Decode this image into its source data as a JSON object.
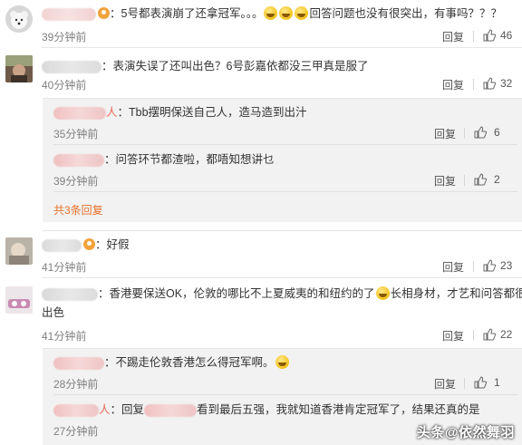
{
  "comments": [
    {
      "text": "：5号都表演崩了还拿冠军。。。",
      "text2": "回答问题也没有很突出，有事吗？？？",
      "time": "39分钟前",
      "reply_label": "回复",
      "likes": "46"
    },
    {
      "text": "：表演失误了还叫出色？6号彭嘉依都没三甲真是服了",
      "time": "40分钟前",
      "reply_label": "回复",
      "likes": "32",
      "replies": [
        {
          "text": "：Tbb摆明保送自己人，造马造到出汁",
          "time": "35分钟前",
          "reply_label": "回复",
          "likes": "6"
        },
        {
          "text": "：问答环节都渣啦，都唔知想讲乜",
          "time": "39分钟前",
          "reply_label": "回复",
          "likes": "2"
        }
      ],
      "more_replies": "共3条回复"
    },
    {
      "text": "：好假",
      "time": "41分钟前",
      "reply_label": "回复",
      "likes": "23"
    },
    {
      "text": "：香港要保送OK，伦敦的哪比不上夏威夷的和纽约的了",
      "text2": "长相身材，才艺和问答都很",
      "text3": "出色",
      "time": "41分钟前",
      "reply_label": "回复",
      "likes": "22",
      "replies": [
        {
          "text": "：不踢走伦敦香港怎么得冠军啊。",
          "time": "28分钟前",
          "reply_label": "回复",
          "likes": "1"
        },
        {
          "name_suffix": "人",
          "text": "：回复",
          "text2": "看到最后五强，我就知道香港肯定冠军了，结果还真的是",
          "time": "27分钟前",
          "reply_label": "回复"
        }
      ]
    }
  ],
  "reply_name_suffix_1": "人",
  "watermark": "头条@依然舞羽"
}
